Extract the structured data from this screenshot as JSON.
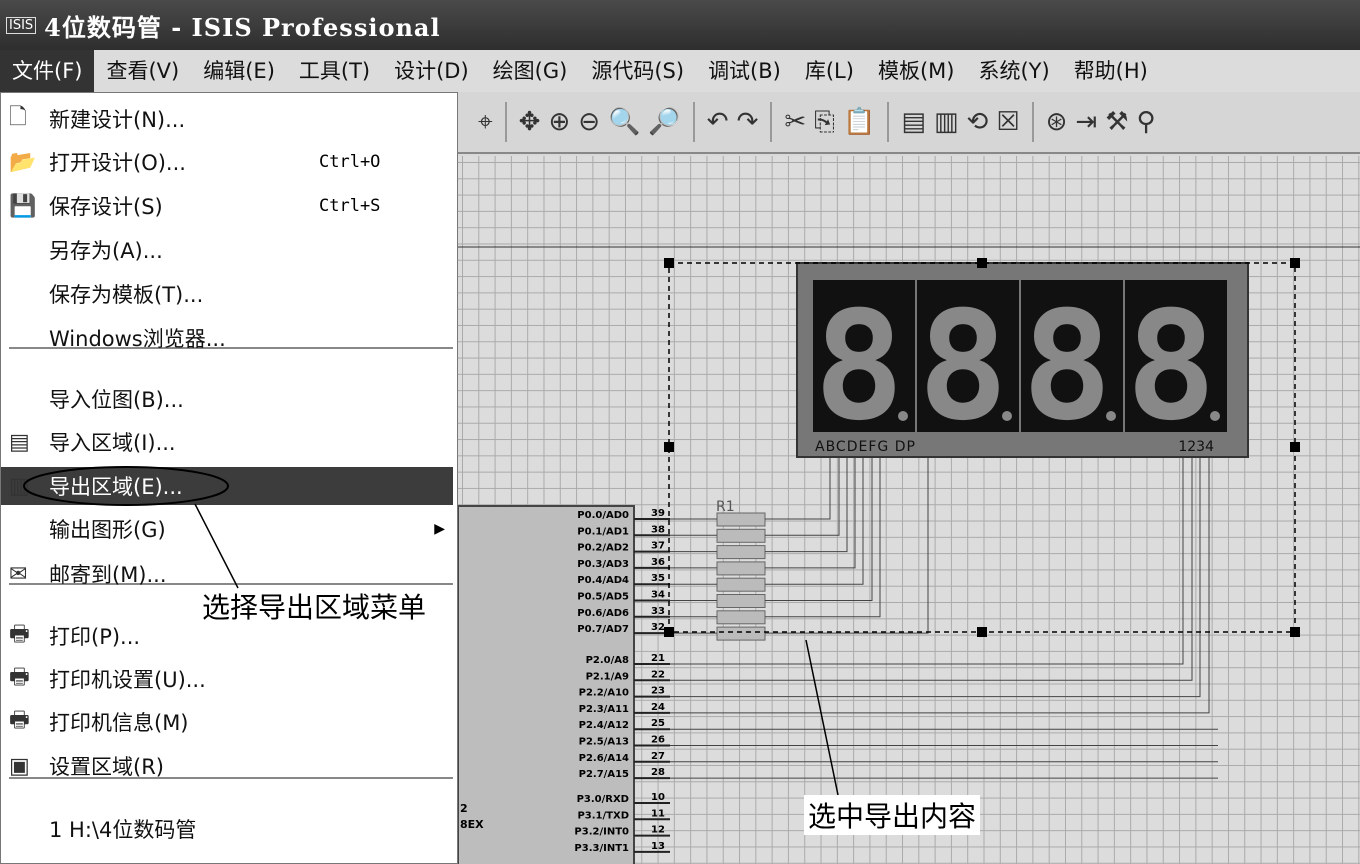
{
  "window": {
    "icon": "ISIS",
    "title": "4位数码管 - ISIS Professional"
  },
  "menubar": [
    "文件(F)",
    "查看(V)",
    "编辑(E)",
    "工具(T)",
    "设计(D)",
    "绘图(G)",
    "源代码(S)",
    "调试(B)",
    "库(L)",
    "模板(M)",
    "系统(Y)",
    "帮助(H)"
  ],
  "file_menu": [
    {
      "icon": "new-file-icon",
      "glyph": "🗋",
      "label": "新建设计(N)...",
      "shortcut": ""
    },
    {
      "icon": "open-folder-icon",
      "glyph": "📂",
      "label": "打开设计(O)...",
      "shortcut": "Ctrl+O"
    },
    {
      "icon": "save-icon",
      "glyph": "💾",
      "label": "保存设计(S)",
      "shortcut": "Ctrl+S"
    },
    {
      "icon": "",
      "glyph": "",
      "label": "另存为(A)...",
      "shortcut": ""
    },
    {
      "icon": "",
      "glyph": "",
      "label": "保存为模板(T)...",
      "shortcut": ""
    },
    {
      "icon": "",
      "glyph": "",
      "label": "Windows浏览器...",
      "shortcut": ""
    },
    {
      "icon": "",
      "glyph": "",
      "label": "导入位图(B)...",
      "shortcut": ""
    },
    {
      "icon": "import-section-icon",
      "glyph": "▤",
      "label": "导入区域(I)...",
      "shortcut": ""
    },
    {
      "icon": "export-section-icon",
      "glyph": "▥",
      "label": "导出区域(E)...",
      "shortcut": ""
    },
    {
      "icon": "",
      "glyph": "",
      "label": "输出图形(G)",
      "shortcut": ""
    },
    {
      "icon": "mail-icon",
      "glyph": "✉",
      "label": "邮寄到(M)...",
      "shortcut": ""
    },
    {
      "icon": "print-icon",
      "glyph": "🖶",
      "label": "打印(P)...",
      "shortcut": ""
    },
    {
      "icon": "printer-setup-icon",
      "glyph": "🖶",
      "label": "打印机设置(U)...",
      "shortcut": ""
    },
    {
      "icon": "printer-info-icon",
      "glyph": "🖶",
      "label": "打印机信息(M)",
      "shortcut": ""
    },
    {
      "icon": "set-area-icon",
      "glyph": "▣",
      "label": "设置区域(R)",
      "shortcut": ""
    },
    {
      "icon": "",
      "glyph": "",
      "label": "1 H:\\4位数码管",
      "shortcut": ""
    }
  ],
  "annotations": {
    "menu": "选择导出区域菜单",
    "selection": "选中导出内容"
  },
  "display": {
    "digits": "8888",
    "seg_label": "ABCDEFG DP",
    "com_label": "1234"
  },
  "resistor_label": "R1",
  "chip": {
    "partial": [
      "2",
      "8EX"
    ],
    "p0": [
      [
        "P0.0/AD0",
        "39"
      ],
      [
        "P0.1/AD1",
        "38"
      ],
      [
        "P0.2/AD2",
        "37"
      ],
      [
        "P0.3/AD3",
        "36"
      ],
      [
        "P0.4/AD4",
        "35"
      ],
      [
        "P0.5/AD5",
        "34"
      ],
      [
        "P0.6/AD6",
        "33"
      ],
      [
        "P0.7/AD7",
        "32"
      ]
    ],
    "p2": [
      [
        "P2.0/A8",
        "21"
      ],
      [
        "P2.1/A9",
        "22"
      ],
      [
        "P2.2/A10",
        "23"
      ],
      [
        "P2.3/A11",
        "24"
      ],
      [
        "P2.4/A12",
        "25"
      ],
      [
        "P2.5/A13",
        "26"
      ],
      [
        "P2.6/A14",
        "27"
      ],
      [
        "P2.7/A15",
        "28"
      ]
    ],
    "p3": [
      [
        "P3.0/RXD",
        "10"
      ],
      [
        "P3.1/TXD",
        "11"
      ],
      [
        "P3.2/INT0",
        "12"
      ],
      [
        "P3.3/INT1",
        "13"
      ]
    ]
  }
}
